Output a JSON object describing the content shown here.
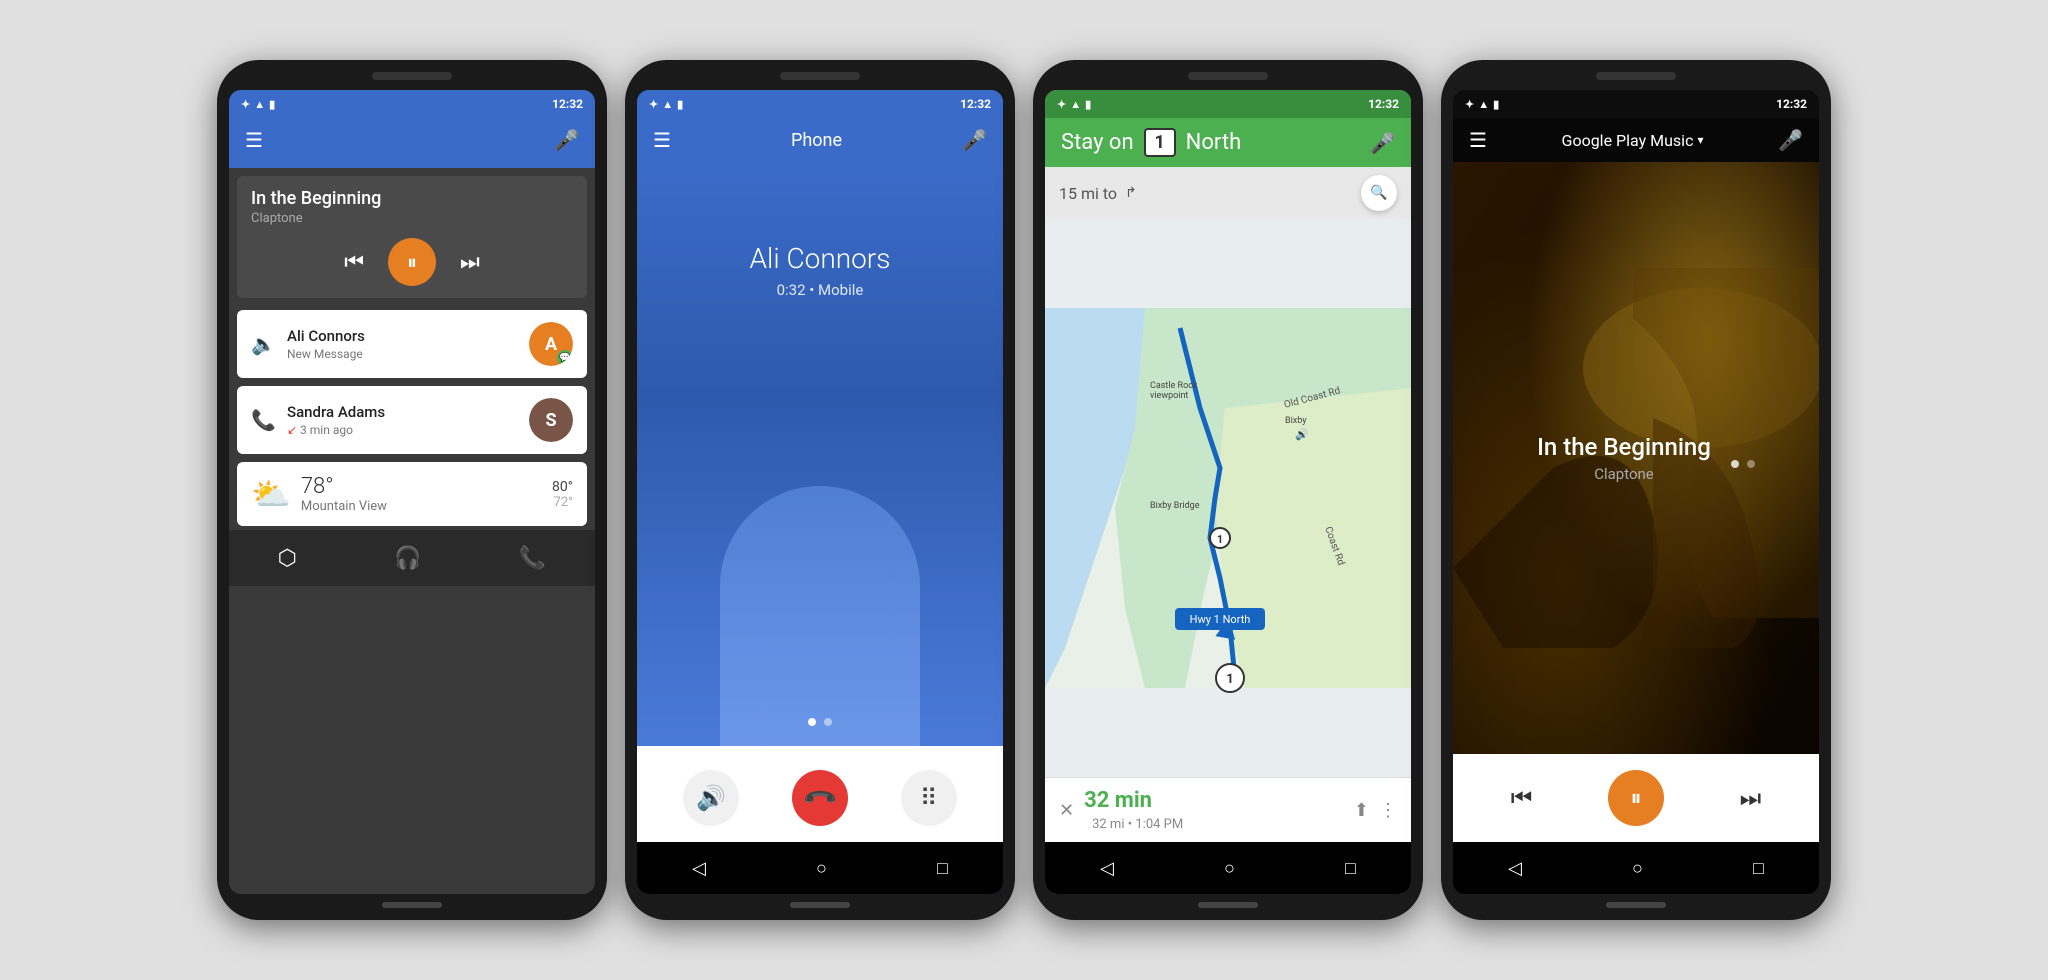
{
  "phone1": {
    "statusBar": {
      "time": "12:32",
      "icons": [
        "bluetooth",
        "signal",
        "battery"
      ]
    },
    "nowPlaying": {
      "title": "In the Beginning",
      "artist": "Claptone"
    },
    "notifications": [
      {
        "type": "message",
        "title": "Ali Connors",
        "subtitle": "New Message",
        "avatarInitial": "A",
        "hasBadge": true
      },
      {
        "type": "call",
        "title": "Sandra Adams",
        "subtitle": "3 min ago",
        "avatarInitial": "S",
        "hasBadge": false
      }
    ],
    "weather": {
      "temp": "78°",
      "city": "Mountain View",
      "high": "80°",
      "low": "72°",
      "icon": "⛅"
    },
    "bottomNav": [
      "navigation",
      "headphones",
      "phone"
    ]
  },
  "phone2": {
    "statusBar": {
      "time": "12:32"
    },
    "header": {
      "label": "Phone"
    },
    "call": {
      "callerName": "Ali Connors",
      "callStatus": "0:32 • Mobile"
    },
    "actions": {
      "speaker": "🔊",
      "endCall": "📞",
      "keypad": "⌨"
    }
  },
  "phone3": {
    "statusBar": {
      "time": "12:32"
    },
    "navigation": {
      "instruction": "Stay on",
      "roadNumber": "1",
      "direction": "North",
      "distance": "15 mi to",
      "turnIcon": "↱"
    },
    "route": {
      "duration": "32 min",
      "distance": "32 mi",
      "eta": "1:04 PM"
    }
  },
  "phone4": {
    "statusBar": {
      "time": "12:32"
    },
    "appName": "Google Play Music",
    "track": {
      "title": "In the Beginning",
      "artist": "Claptone"
    }
  }
}
